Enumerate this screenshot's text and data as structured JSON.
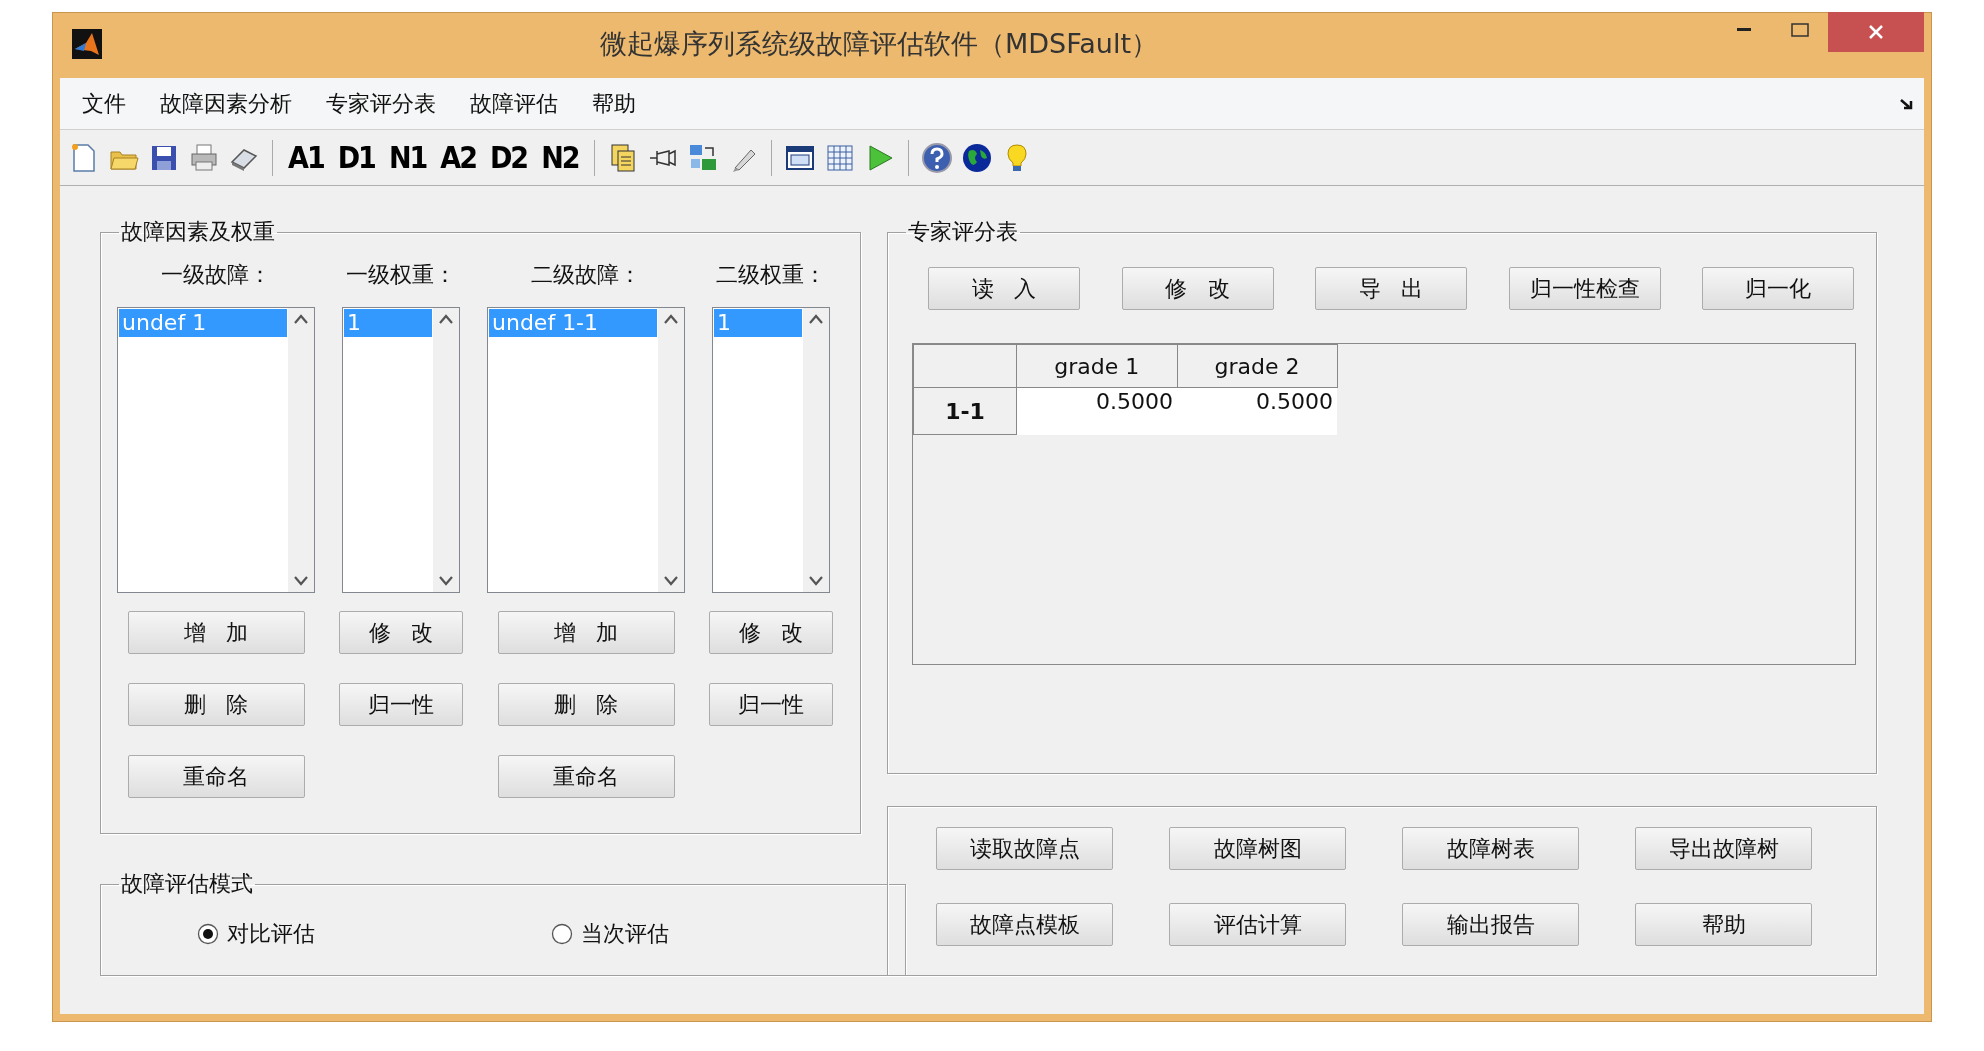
{
  "window": {
    "title": "微起爆序列系统级故障评估软件（MDSFault）"
  },
  "menu": [
    "文件",
    "故障因素分析",
    "专家评分表",
    "故障评估",
    "帮助"
  ],
  "toolbar_labels": [
    "A1",
    "D1",
    "N1",
    "A2",
    "D2",
    "N2"
  ],
  "factors": {
    "title": "故障因素及权重",
    "columns": [
      {
        "header": "一级故障：",
        "items": [
          {
            "text": "undef 1",
            "selected": true
          }
        ],
        "buttons": [
          "增 加",
          "删 除",
          "重命名"
        ]
      },
      {
        "header": "一级权重：",
        "items": [
          {
            "text": "1",
            "selected": true
          }
        ],
        "buttons": [
          "修 改",
          "归一性"
        ]
      },
      {
        "header": "二级故障：",
        "items": [
          {
            "text": "undef 1-1",
            "selected": true
          }
        ],
        "buttons": [
          "增 加",
          "删 除",
          "重命名"
        ]
      },
      {
        "header": "二级权重：",
        "items": [
          {
            "text": "1",
            "selected": true
          }
        ],
        "buttons": [
          "修 改",
          "归一性"
        ]
      }
    ]
  },
  "mode": {
    "title": "故障评估模式",
    "options": [
      {
        "label": "对比评估",
        "selected": true
      },
      {
        "label": "当次评估",
        "selected": false
      }
    ]
  },
  "expert": {
    "title": "专家评分表",
    "buttons": [
      "读 入",
      "修 改",
      "导 出",
      "归一性检查",
      "归一化"
    ],
    "table": {
      "columns": [
        "grade 1",
        "grade 2"
      ],
      "rows": [
        {
          "header": "1-1",
          "cells": [
            "0.5000",
            "0.5000"
          ]
        }
      ]
    }
  },
  "actions": [
    [
      "读取故障点",
      "故障树图",
      "故障树表",
      "导出故障树"
    ],
    [
      "故障点模板",
      "评估计算",
      "输出报告",
      "帮助"
    ]
  ]
}
